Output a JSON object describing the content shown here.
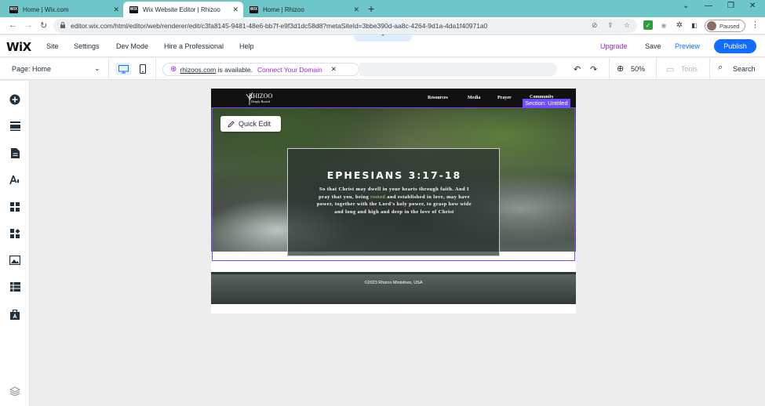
{
  "browser": {
    "tabs": [
      {
        "favicon": "WIX",
        "title": "Home | Wix.com",
        "active": false
      },
      {
        "favicon": "WIX",
        "title": "Wix Website Editor | Rhizoo",
        "active": true
      },
      {
        "favicon": "WIX",
        "title": "Home | Rhizoo",
        "active": false
      }
    ],
    "url": "editor.wix.com/html/editor/web/renderer/edit/c3fa8145-9481-48e6-bb7f-e9f3d1dc58d8?metaSiteId=3bbe390d-aa8c-4264-9d1a-4da1f40971a0",
    "profile_status": "Paused"
  },
  "wix_topbar": {
    "logo": "WiX",
    "menu": [
      "Site",
      "Settings",
      "Dev Mode",
      "Hire a Professional",
      "Help"
    ],
    "upgrade": "Upgrade",
    "save": "Save",
    "preview": "Preview",
    "publish": "Publish",
    "accent_color": "#116dff",
    "upgrade_color": "#9a27d5"
  },
  "wix_toolbar": {
    "page_selector": "Page: Home",
    "domain_name": "rhizoos.com",
    "domain_status": " is available.",
    "connect_domain": "Connect Your Domain",
    "zoom": "50%",
    "tools": "Tools",
    "search": "Search"
  },
  "left_rail": {
    "icons": [
      "add-icon",
      "sections-icon",
      "pages-icon",
      "theme-icon",
      "apps-icon",
      "business-icon",
      "media-icon",
      "cms-icon",
      "portfolio-icon",
      "layers-icon"
    ]
  },
  "site": {
    "logo_main": "RHIZOO",
    "logo_sub": "Deeply Rooted",
    "nav": [
      "Resources",
      "Media",
      "Prayer",
      "Community"
    ],
    "section_label": "Section: Untitled",
    "quick_edit": "Quick Edit",
    "verse_title": "EPHESIANS 3:17-18",
    "verse_before": "So that Christ may dwell in your hearts through faith. And I pray that you, being ",
    "verse_highlight": "rooted",
    "verse_after": " and established in love, may have power, together with the Lord's holy power, to grasp how wide and long and high and deep in the love of Christ",
    "footer_text": "©2023 Rhizoo Ministries, USA",
    "selection_color": "#6f4cff"
  }
}
